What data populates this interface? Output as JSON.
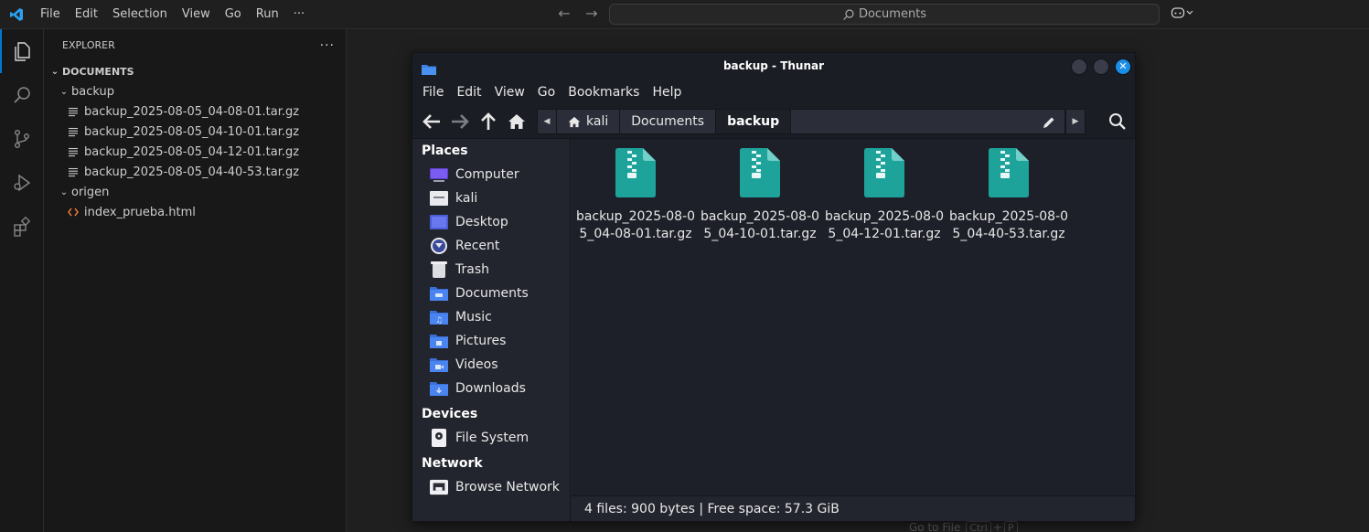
{
  "vscode": {
    "menu": [
      "File",
      "Edit",
      "Selection",
      "View",
      "Go",
      "Run",
      "···"
    ],
    "command_center": "Documents",
    "explorer": {
      "title": "EXPLORER",
      "more": "···",
      "section": "DOCUMENTS",
      "tree": [
        {
          "type": "folder",
          "label": "backup",
          "depth": 1
        },
        {
          "type": "file",
          "label": "backup_2025-08-05_04-08-01.tar.gz",
          "depth": 2
        },
        {
          "type": "file",
          "label": "backup_2025-08-05_04-10-01.tar.gz",
          "depth": 2
        },
        {
          "type": "file",
          "label": "backup_2025-08-05_04-12-01.tar.gz",
          "depth": 2
        },
        {
          "type": "file",
          "label": "backup_2025-08-05_04-40-53.tar.gz",
          "depth": 2
        },
        {
          "type": "folder",
          "label": "origen",
          "depth": 1
        },
        {
          "type": "html",
          "label": "index_prueba.html",
          "depth": 2
        }
      ]
    },
    "goto_hint": {
      "label": "Go to File",
      "key1": "Ctrl",
      "plus": "+",
      "key2": "P"
    }
  },
  "thunar": {
    "title": "backup - Thunar",
    "menu": [
      "File",
      "Edit",
      "View",
      "Go",
      "Bookmarks",
      "Help"
    ],
    "breadcrumbs": [
      "kali",
      "Documents",
      "backup"
    ],
    "sidebar": {
      "places_title": "Places",
      "places": [
        {
          "label": "Computer",
          "icon": "computer-icon"
        },
        {
          "label": "kali",
          "icon": "home-folder-icon"
        },
        {
          "label": "Desktop",
          "icon": "desktop-icon"
        },
        {
          "label": "Recent",
          "icon": "recent-icon"
        },
        {
          "label": "Trash",
          "icon": "trash-icon"
        },
        {
          "label": "Documents",
          "icon": "documents-folder-icon"
        },
        {
          "label": "Music",
          "icon": "music-folder-icon"
        },
        {
          "label": "Pictures",
          "icon": "pictures-folder-icon"
        },
        {
          "label": "Videos",
          "icon": "videos-folder-icon"
        },
        {
          "label": "Downloads",
          "icon": "downloads-folder-icon"
        }
      ],
      "devices_title": "Devices",
      "devices": [
        {
          "label": "File System",
          "icon": "drive-icon"
        }
      ],
      "network_title": "Network",
      "network": [
        {
          "label": "Browse Network",
          "icon": "network-icon"
        }
      ]
    },
    "files": [
      {
        "name": "backup_2025-08-05_04-08-01.tar.gz"
      },
      {
        "name": "backup_2025-08-05_04-10-01.tar.gz"
      },
      {
        "name": "backup_2025-08-05_04-12-01.tar.gz"
      },
      {
        "name": "backup_2025-08-05_04-40-53.tar.gz"
      }
    ],
    "status": "4 files: 900 bytes  |  Free space: 57.3 GiB"
  },
  "colors": {
    "accent": "#0078d4",
    "archive": "#1ea39b",
    "folder": "#3b82e6"
  }
}
